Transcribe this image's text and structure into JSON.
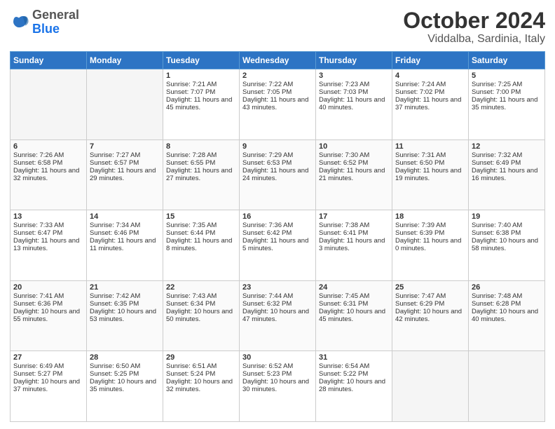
{
  "header": {
    "logo_general": "General",
    "logo_blue": "Blue",
    "month_title": "October 2024",
    "location": "Viddalba, Sardinia, Italy"
  },
  "days_of_week": [
    "Sunday",
    "Monday",
    "Tuesday",
    "Wednesday",
    "Thursday",
    "Friday",
    "Saturday"
  ],
  "weeks": [
    [
      {
        "day": "",
        "empty": true
      },
      {
        "day": "",
        "empty": true
      },
      {
        "day": "1",
        "sunrise": "Sunrise: 7:21 AM",
        "sunset": "Sunset: 7:07 PM",
        "daylight": "Daylight: 11 hours and 45 minutes."
      },
      {
        "day": "2",
        "sunrise": "Sunrise: 7:22 AM",
        "sunset": "Sunset: 7:05 PM",
        "daylight": "Daylight: 11 hours and 43 minutes."
      },
      {
        "day": "3",
        "sunrise": "Sunrise: 7:23 AM",
        "sunset": "Sunset: 7:03 PM",
        "daylight": "Daylight: 11 hours and 40 minutes."
      },
      {
        "day": "4",
        "sunrise": "Sunrise: 7:24 AM",
        "sunset": "Sunset: 7:02 PM",
        "daylight": "Daylight: 11 hours and 37 minutes."
      },
      {
        "day": "5",
        "sunrise": "Sunrise: 7:25 AM",
        "sunset": "Sunset: 7:00 PM",
        "daylight": "Daylight: 11 hours and 35 minutes."
      }
    ],
    [
      {
        "day": "6",
        "sunrise": "Sunrise: 7:26 AM",
        "sunset": "Sunset: 6:58 PM",
        "daylight": "Daylight: 11 hours and 32 minutes."
      },
      {
        "day": "7",
        "sunrise": "Sunrise: 7:27 AM",
        "sunset": "Sunset: 6:57 PM",
        "daylight": "Daylight: 11 hours and 29 minutes."
      },
      {
        "day": "8",
        "sunrise": "Sunrise: 7:28 AM",
        "sunset": "Sunset: 6:55 PM",
        "daylight": "Daylight: 11 hours and 27 minutes."
      },
      {
        "day": "9",
        "sunrise": "Sunrise: 7:29 AM",
        "sunset": "Sunset: 6:53 PM",
        "daylight": "Daylight: 11 hours and 24 minutes."
      },
      {
        "day": "10",
        "sunrise": "Sunrise: 7:30 AM",
        "sunset": "Sunset: 6:52 PM",
        "daylight": "Daylight: 11 hours and 21 minutes."
      },
      {
        "day": "11",
        "sunrise": "Sunrise: 7:31 AM",
        "sunset": "Sunset: 6:50 PM",
        "daylight": "Daylight: 11 hours and 19 minutes."
      },
      {
        "day": "12",
        "sunrise": "Sunrise: 7:32 AM",
        "sunset": "Sunset: 6:49 PM",
        "daylight": "Daylight: 11 hours and 16 minutes."
      }
    ],
    [
      {
        "day": "13",
        "sunrise": "Sunrise: 7:33 AM",
        "sunset": "Sunset: 6:47 PM",
        "daylight": "Daylight: 11 hours and 13 minutes."
      },
      {
        "day": "14",
        "sunrise": "Sunrise: 7:34 AM",
        "sunset": "Sunset: 6:46 PM",
        "daylight": "Daylight: 11 hours and 11 minutes."
      },
      {
        "day": "15",
        "sunrise": "Sunrise: 7:35 AM",
        "sunset": "Sunset: 6:44 PM",
        "daylight": "Daylight: 11 hours and 8 minutes."
      },
      {
        "day": "16",
        "sunrise": "Sunrise: 7:36 AM",
        "sunset": "Sunset: 6:42 PM",
        "daylight": "Daylight: 11 hours and 5 minutes."
      },
      {
        "day": "17",
        "sunrise": "Sunrise: 7:38 AM",
        "sunset": "Sunset: 6:41 PM",
        "daylight": "Daylight: 11 hours and 3 minutes."
      },
      {
        "day": "18",
        "sunrise": "Sunrise: 7:39 AM",
        "sunset": "Sunset: 6:39 PM",
        "daylight": "Daylight: 11 hours and 0 minutes."
      },
      {
        "day": "19",
        "sunrise": "Sunrise: 7:40 AM",
        "sunset": "Sunset: 6:38 PM",
        "daylight": "Daylight: 10 hours and 58 minutes."
      }
    ],
    [
      {
        "day": "20",
        "sunrise": "Sunrise: 7:41 AM",
        "sunset": "Sunset: 6:36 PM",
        "daylight": "Daylight: 10 hours and 55 minutes."
      },
      {
        "day": "21",
        "sunrise": "Sunrise: 7:42 AM",
        "sunset": "Sunset: 6:35 PM",
        "daylight": "Daylight: 10 hours and 53 minutes."
      },
      {
        "day": "22",
        "sunrise": "Sunrise: 7:43 AM",
        "sunset": "Sunset: 6:34 PM",
        "daylight": "Daylight: 10 hours and 50 minutes."
      },
      {
        "day": "23",
        "sunrise": "Sunrise: 7:44 AM",
        "sunset": "Sunset: 6:32 PM",
        "daylight": "Daylight: 10 hours and 47 minutes."
      },
      {
        "day": "24",
        "sunrise": "Sunrise: 7:45 AM",
        "sunset": "Sunset: 6:31 PM",
        "daylight": "Daylight: 10 hours and 45 minutes."
      },
      {
        "day": "25",
        "sunrise": "Sunrise: 7:47 AM",
        "sunset": "Sunset: 6:29 PM",
        "daylight": "Daylight: 10 hours and 42 minutes."
      },
      {
        "day": "26",
        "sunrise": "Sunrise: 7:48 AM",
        "sunset": "Sunset: 6:28 PM",
        "daylight": "Daylight: 10 hours and 40 minutes."
      }
    ],
    [
      {
        "day": "27",
        "sunrise": "Sunrise: 6:49 AM",
        "sunset": "Sunset: 5:27 PM",
        "daylight": "Daylight: 10 hours and 37 minutes."
      },
      {
        "day": "28",
        "sunrise": "Sunrise: 6:50 AM",
        "sunset": "Sunset: 5:25 PM",
        "daylight": "Daylight: 10 hours and 35 minutes."
      },
      {
        "day": "29",
        "sunrise": "Sunrise: 6:51 AM",
        "sunset": "Sunset: 5:24 PM",
        "daylight": "Daylight: 10 hours and 32 minutes."
      },
      {
        "day": "30",
        "sunrise": "Sunrise: 6:52 AM",
        "sunset": "Sunset: 5:23 PM",
        "daylight": "Daylight: 10 hours and 30 minutes."
      },
      {
        "day": "31",
        "sunrise": "Sunrise: 6:54 AM",
        "sunset": "Sunset: 5:22 PM",
        "daylight": "Daylight: 10 hours and 28 minutes."
      },
      {
        "day": "",
        "empty": true
      },
      {
        "day": "",
        "empty": true
      }
    ]
  ]
}
